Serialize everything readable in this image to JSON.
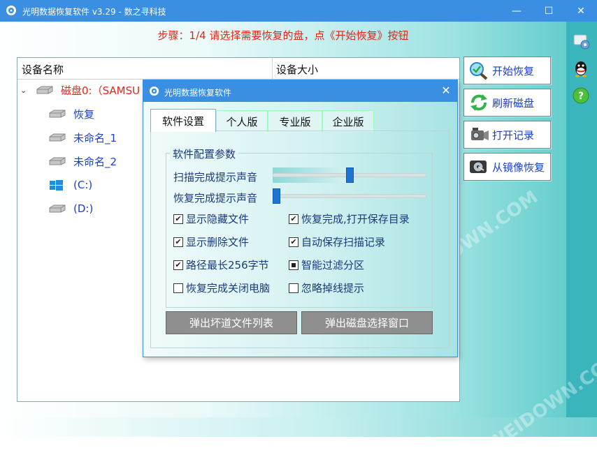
{
  "window": {
    "title": "光明数据恢复软件 v3.29 - 数之寻科技",
    "minimize_glyph": "—",
    "maximize_glyph": "☐",
    "close_glyph": "✕"
  },
  "step_text": "步骤：1/4 请选择需要恢复的盘，点《开始恢复》按钮",
  "device_list": {
    "columns": [
      "设备名称",
      "设备大小"
    ],
    "items": [
      {
        "label": "磁盘0:（SAMSU",
        "icon": "hard-disk-icon",
        "color": "#e0261b",
        "expanded": true
      },
      {
        "label": "恢复",
        "icon": "partition-icon"
      },
      {
        "label": "未命名_1",
        "icon": "partition-icon"
      },
      {
        "label": "未命名_2",
        "icon": "partition-icon"
      },
      {
        "label": "(C:)",
        "icon": "windows-logo-icon"
      },
      {
        "label": "(D:)",
        "icon": "partition-icon"
      }
    ]
  },
  "right_buttons": [
    {
      "label": "开始恢复",
      "icon": "magnifier-recover-icon"
    },
    {
      "label": "刷新磁盘",
      "icon": "refresh-icon"
    },
    {
      "label": "打开记录",
      "icon": "camcorder-icon"
    },
    {
      "label": "从镜像恢复",
      "icon": "disk-image-icon"
    }
  ],
  "side_icons": [
    "settings-icon",
    "qq-icon",
    "help-icon"
  ],
  "dialog": {
    "title": "光明数据恢复软件",
    "close_glyph": "✕",
    "tabs": [
      "软件设置",
      "个人版",
      "专业版",
      "企业版"
    ],
    "active_tab": 0,
    "group_title": "软件配置参数",
    "sliders": [
      {
        "label": "扫描完成提示声音",
        "value": 0.5
      },
      {
        "label": "恢复完成提示声音",
        "value": 0.0
      }
    ],
    "checkboxes": [
      {
        "label": "显示隐藏文件",
        "checked": true
      },
      {
        "label": "恢复完成,打开保存目录",
        "checked": true
      },
      {
        "label": "显示删除文件",
        "checked": true
      },
      {
        "label": "自动保存扫描记录",
        "checked": true
      },
      {
        "label": "路径最长256字节",
        "checked": true
      },
      {
        "label": "智能过滤分区",
        "checked": "indeterminate"
      },
      {
        "label": "恢复完成关闭电脑",
        "checked": false
      },
      {
        "label": "忽略掉线提示",
        "checked": false
      }
    ],
    "buttons": [
      "弹出坏道文件列表",
      "弹出磁盘选择窗口"
    ]
  },
  "watermark": "WEIDOWN.COM",
  "colors": {
    "titlebar": "#3a8fe3",
    "step_text": "#e0261b",
    "link_blue": "#1a3fc8",
    "teal": "#3bb5bc"
  }
}
